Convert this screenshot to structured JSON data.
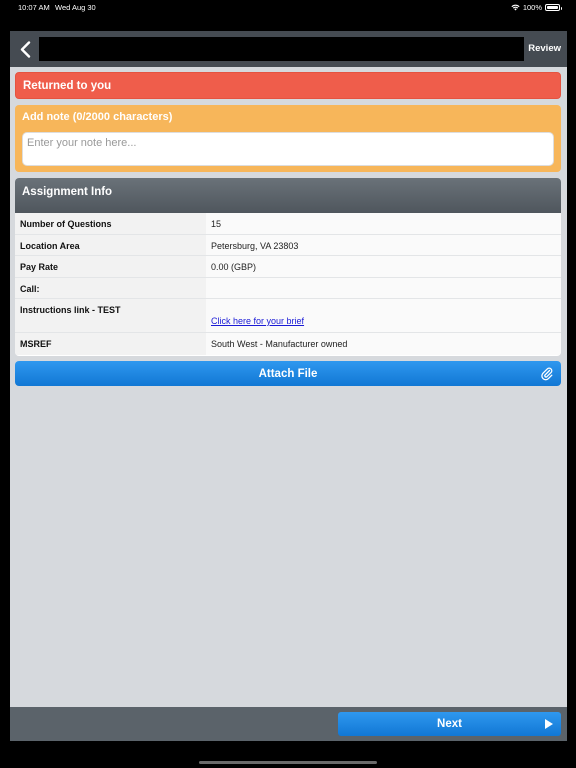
{
  "status_bar": {
    "time": "10:07 AM",
    "date": "Wed Aug 30",
    "battery": "100%"
  },
  "nav": {
    "title": "",
    "review_label": "Review"
  },
  "returned_banner": "Returned to you",
  "note": {
    "label": "Add note (0/2000 characters)",
    "placeholder": "Enter your note here...",
    "value": ""
  },
  "assignment": {
    "header": "Assignment Info",
    "rows": [
      {
        "label": "Number of Questions",
        "value": "15"
      },
      {
        "label": "Location Area",
        "value": "Petersburg, VA 23803"
      },
      {
        "label": "Pay Rate",
        "value": "0.00 (GBP)"
      },
      {
        "label": "Call:",
        "value": ""
      },
      {
        "label": "Instructions link - TEST",
        "value": "Click here for your brief"
      },
      {
        "label": "MSREF",
        "value": "South West - Manufacturer owned"
      }
    ]
  },
  "attach_label": "Attach File",
  "next_label": "Next",
  "colors": {
    "returned_banner": "#ef5d4b",
    "note_panel": "#f7b65a",
    "primary_button": "#1a86e3",
    "nav_bar": "#454b52",
    "background": "#d6d9dd"
  }
}
